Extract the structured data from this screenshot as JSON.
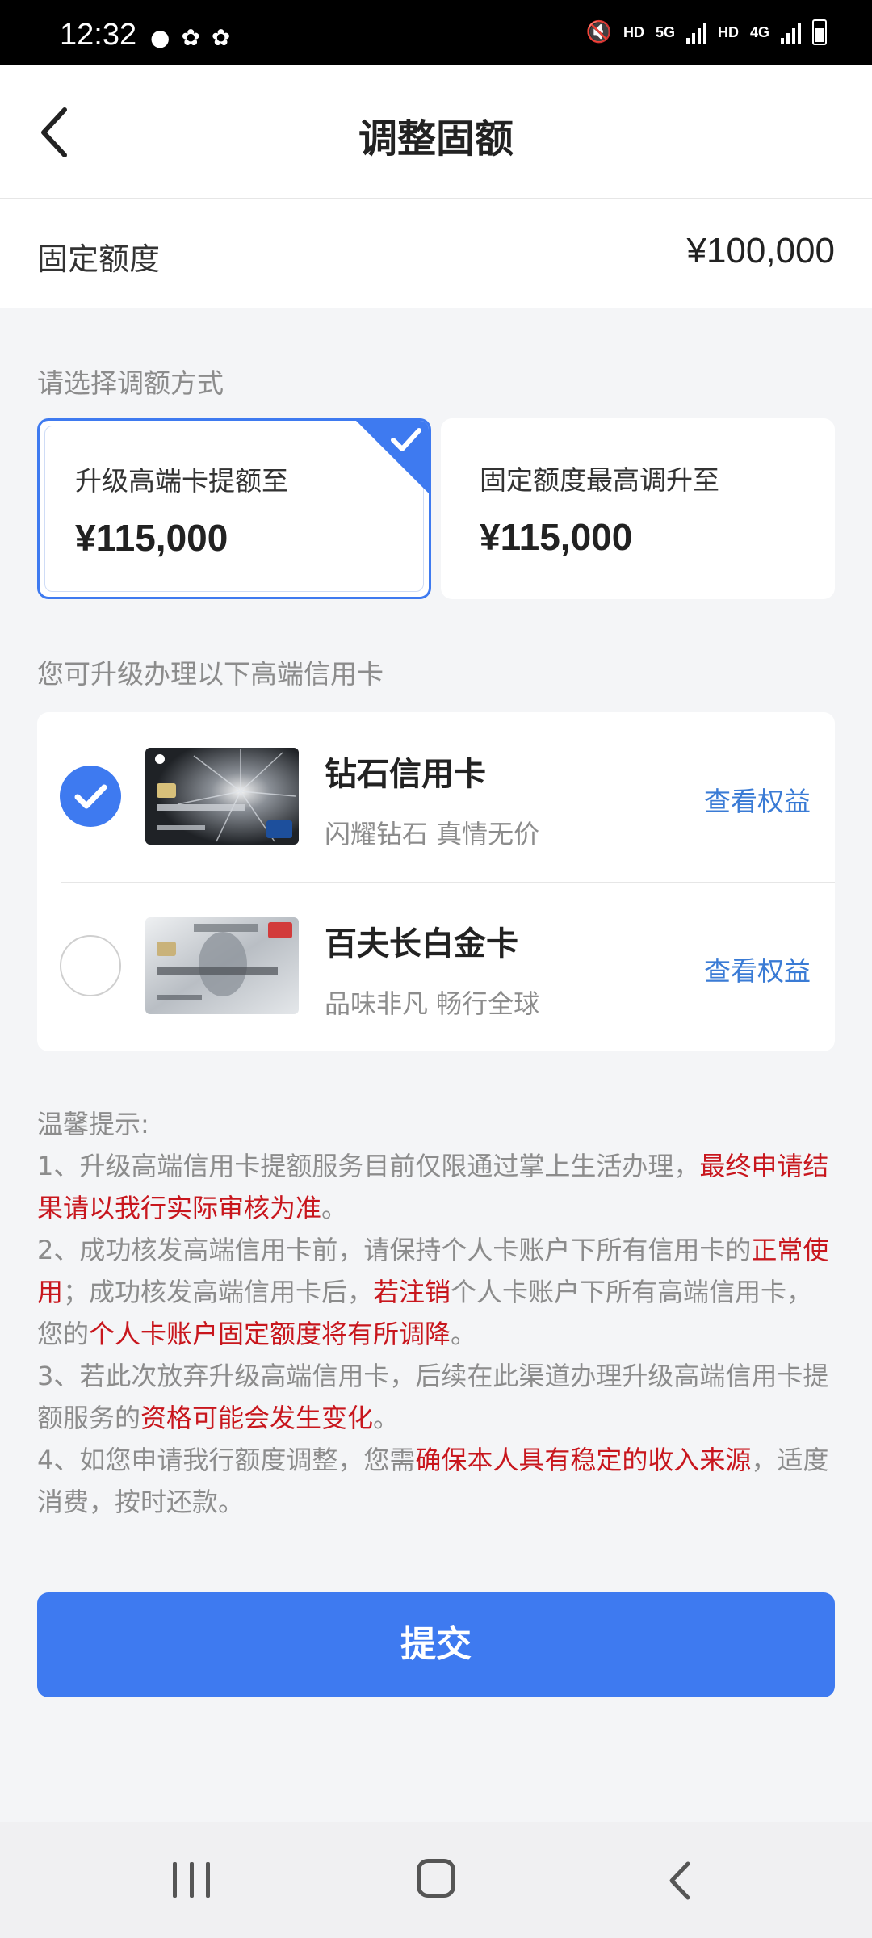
{
  "status_bar": {
    "time": "12:32",
    "labels": [
      "HD",
      "5G",
      "HD",
      "4G"
    ]
  },
  "header": {
    "title": "调整固额"
  },
  "limit": {
    "label": "固定额度",
    "value": "¥100,000"
  },
  "adjust": {
    "section_label": "请选择调额方式",
    "options": [
      {
        "title": "升级高端卡提额至",
        "amount": "¥115,000",
        "selected": true
      },
      {
        "title": "固定额度最高调升至",
        "amount": "¥115,000",
        "selected": false
      }
    ]
  },
  "cards": {
    "section_label": "您可升级办理以下高端信用卡",
    "items": [
      {
        "name": "钻石信用卡",
        "slogan": "闪耀钻石 真情无价",
        "link": "查看权益",
        "selected": true
      },
      {
        "name": "百夫长白金卡",
        "slogan": "品味非凡 畅行全球",
        "link": "查看权益",
        "selected": false
      }
    ]
  },
  "tips": {
    "heading": "温馨提示:",
    "t1a": "1、升级高端信用卡提额服务目前仅限通过掌上生活办理，",
    "t1b": "最终申请结果请以我行实际审核为准",
    "t1c": "。",
    "t2a": "2、成功核发高端信用卡前，请保持个人卡账户下所有信用卡的",
    "t2b": "正常使用",
    "t2c": "；成功核发高端信用卡后，",
    "t2d": "若注销",
    "t2e": "个人卡账户下所有高端信用卡，您的",
    "t2f": "个人卡账户固定额度将有所调降",
    "t2g": "。",
    "t3a": "3、若此次放弃升级高端信用卡，后续在此渠道办理升级高端信用卡提额服务的",
    "t3b": "资格可能会发生变化",
    "t3c": "。",
    "t4a": "4、如您申请我行额度调整，您需",
    "t4b": "确保本人具有稳定的收入来源",
    "t4c": "，适度消费，按时还款。"
  },
  "submit_label": "提交",
  "colors": {
    "accent": "#3e7af0",
    "warning_red": "#c8161d",
    "link_blue": "#3a7bd5"
  }
}
